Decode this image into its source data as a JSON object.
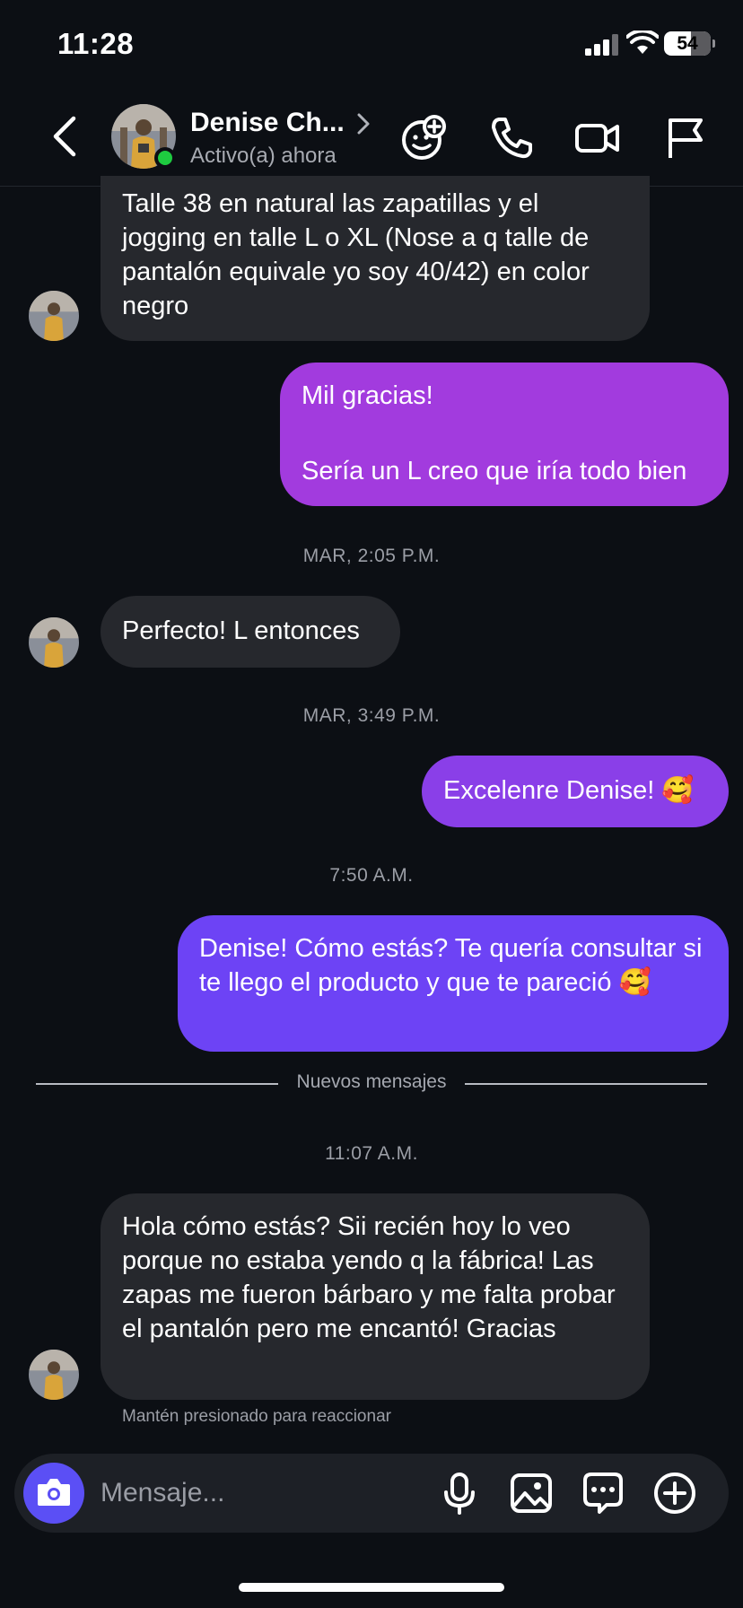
{
  "status_bar": {
    "time": "11:28",
    "battery": "54"
  },
  "header": {
    "name": "Denise Ch...",
    "status": "Activo(a) ahora"
  },
  "messages": {
    "m1": "Talle 38 en natural las zapatillas y el jogging en talle L o XL (Nose a q talle de pantalón equivale yo soy 40/42) en color negro",
    "m2_line1": "Mil gracias!",
    "m2_line2": "Sería un L creo que iría todo bien",
    "ts1": "MAR, 2:05 P.M.",
    "m3": "Perfecto! L entonces",
    "ts2": "MAR, 3:49 P.M.",
    "m4": "Excelenre Denise! 🥰",
    "ts3": "7:50 A.M.",
    "m5": "Denise! Cómo estás? Te quería consultar si te llego el producto y que te pareció 🥰",
    "divider": "Nuevos mensajes",
    "ts4": "11:07 A.M.",
    "m6": "Hola cómo estás? Sii recién hoy lo veo porque no estaba yendo q la fábrica! Las zapas me fueron bárbaro y me falta probar el pantalón pero me encantó! Gracias",
    "hint": "Mantén presionado para reaccionar"
  },
  "composer": {
    "placeholder": "Mensaje..."
  },
  "colors": {
    "background": "#0c0f14",
    "incoming_bubble": "#26282d",
    "outgoing_top": "#a23bde",
    "outgoing_bottom": "#6d43f5",
    "online": "#1ecb40",
    "camera_button": "#5b4ff5"
  },
  "icons": {
    "back": "chevron-left-icon",
    "chevron": "chevron-right-icon",
    "add_face": "face-plus-icon",
    "call": "phone-icon",
    "video": "video-camera-icon",
    "report": "flag-icon",
    "camera": "camera-icon",
    "mic": "microphone-icon",
    "gallery": "image-icon",
    "sticker": "chat-bubble-icon",
    "more": "plus-circle-icon"
  }
}
